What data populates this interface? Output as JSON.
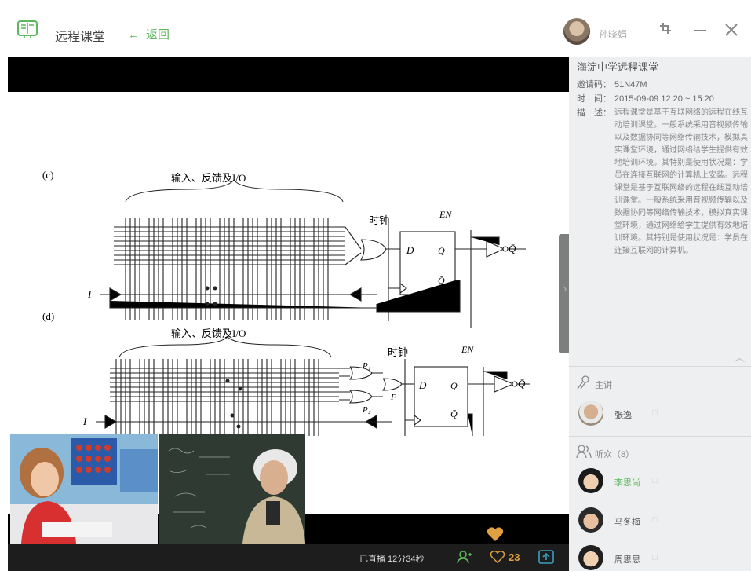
{
  "app": {
    "title": "远程课堂",
    "back_label": "返回"
  },
  "user": {
    "name": "孙晓娟"
  },
  "window": {
    "restore_icon": "restore-icon",
    "minimize_icon": "minimize-icon",
    "close_icon": "close-icon"
  },
  "course": {
    "title": "海淀中学远程课堂",
    "code_label": "邀请码：",
    "code": "51N47M",
    "time_label": "时　间：",
    "time": "2015-09-09 12:20 ~ 15:20",
    "desc_label": "描　述：",
    "description": "远程课堂是基于互联网络的远程在线互动培训课堂。一般系统采用音视频传输以及数据协同等网络传输技术，模拟真实课堂环境，通过网络给学生提供有效地培训环境。其特别是使用状况是：学员在连接互联网的计算机上安装。远程课堂是基于互联网络的远程在线互动培训课堂。一般系统采用音视频传输以及数据协同等网络传输技术，模拟真实课堂环境，通过网络给学生提供有效地培训环境。其特别是使用状况是：学员在连接互联网的计算机。"
  },
  "lecturer": {
    "section_label": "主讲",
    "name": "张逸"
  },
  "audience": {
    "section_label": "听众（8）",
    "members": [
      {
        "name": "李思尚",
        "color": "#5cb85c"
      },
      {
        "name": "马冬梅",
        "color": "#555555"
      },
      {
        "name": "周思思",
        "color": "#555555"
      }
    ]
  },
  "diagram": {
    "label_top": "输入、反馈及I/O",
    "label_bottom": "输入、反馈及I/O",
    "clock_top": "时钟",
    "clock_bottom": "时钟",
    "en_top": "EN",
    "en_bottom": "EN",
    "c_label": "(c)",
    "d_label": "(d)",
    "i_label": "I",
    "q": "Q",
    "qbar": "Q̄",
    "d": "D",
    "p1": "P₁",
    "p2": "P₂",
    "f": "F"
  },
  "status": {
    "live_time": "已直播 12分34秒",
    "likes": "23"
  },
  "colors": {
    "accent": "#5cb85c",
    "like": "#e0a040",
    "panel_bg": "#eeeff1"
  }
}
